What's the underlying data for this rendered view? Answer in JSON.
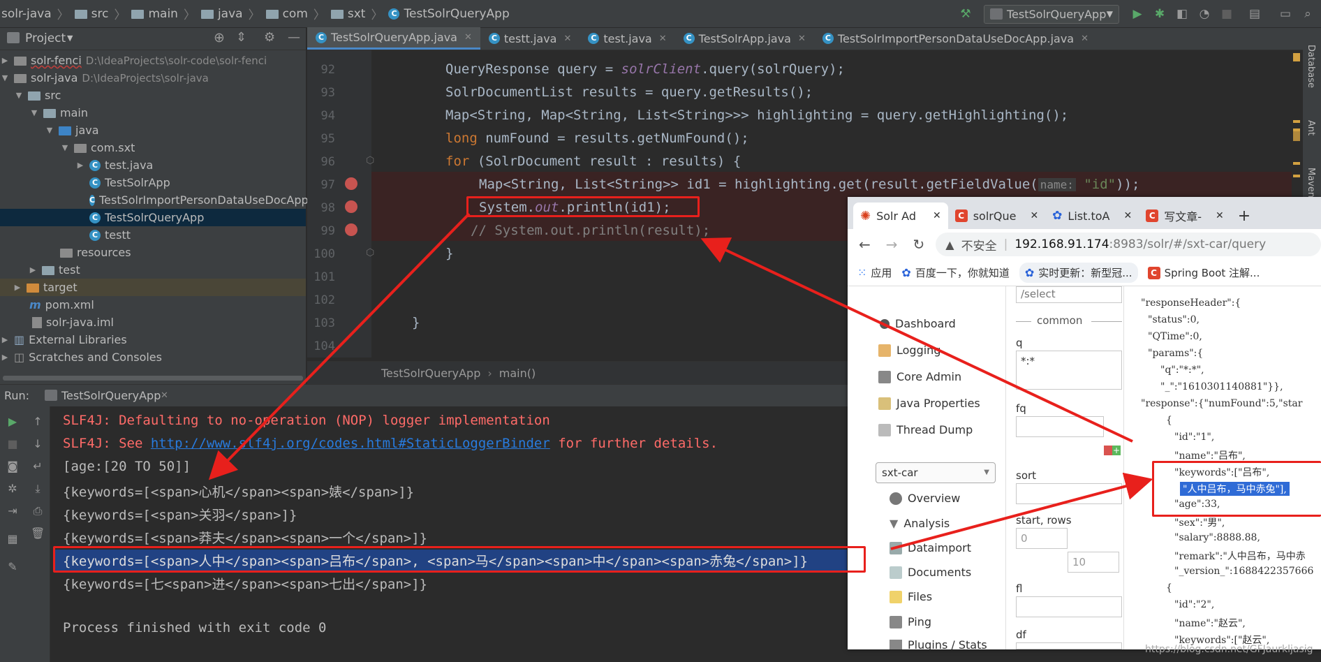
{
  "navbar": {
    "crumbs": [
      "solr-java",
      "src",
      "main",
      "java",
      "com",
      "sxt",
      "TestSolrQueryApp"
    ],
    "run_config": "TestSolrQueryApp"
  },
  "project_panel": {
    "title": "Project",
    "tree": [
      {
        "name": "solr-fenci",
        "path": "D:\\IdeaProjects\\solr-code\\solr-fenci"
      },
      {
        "name": "solr-java",
        "path": "D:\\IdeaProjects\\solr-java"
      },
      {
        "name": "src"
      },
      {
        "name": "main"
      },
      {
        "name": "java"
      },
      {
        "name": "com.sxt"
      },
      {
        "name": "test.java"
      },
      {
        "name": "TestSolrApp"
      },
      {
        "name": "TestSolrImportPersonDataUseDocApp"
      },
      {
        "name": "TestSolrQueryApp"
      },
      {
        "name": "testt"
      },
      {
        "name": "resources"
      },
      {
        "name": "test"
      },
      {
        "name": "target"
      },
      {
        "name": "pom.xml"
      },
      {
        "name": "solr-java.iml"
      },
      {
        "name": "External Libraries"
      },
      {
        "name": "Scratches and Consoles"
      }
    ]
  },
  "editor": {
    "tabs": [
      "TestSolrQueryApp.java",
      "testt.java",
      "test.java",
      "TestSolrApp.java",
      "TestSolrImportPersonDataUseDocApp.java"
    ],
    "line_numbers": [
      "92",
      "93",
      "94",
      "95",
      "96",
      "97",
      "98",
      "99",
      "100",
      "101",
      "102",
      "103",
      "104"
    ],
    "lines": {
      "l92a": "QueryResponse query = ",
      "l92b": "solrClient",
      "l92c": ".query(solrQuery);",
      "l93": "SolrDocumentList results = query.getResults();",
      "l94": "Map<String, Map<String, List<String>>> highlighting = query.getHighlighting();",
      "l95a": "long",
      "l95b": " numFound = results.getNumFound();",
      "l96a": "for",
      "l96b": " (SolrDocument result : results) {",
      "l97a": "Map<String, List<String>> id1 = highlighting.get(result.getFieldValue(",
      "l97hint": "name:",
      "l97str": "\"id\"",
      "l97c": "));",
      "l98a": "System.",
      "l98b": "out",
      "l98c": ".println(id1);",
      "l99": "// System.out.println(result);",
      "l100": "}",
      "l103": "}"
    },
    "breadcrumb": [
      "TestSolrQueryApp",
      "main()"
    ],
    "right_tools": [
      "Database",
      "Ant",
      "Maven"
    ]
  },
  "run_panel": {
    "label": "Run:",
    "tab": "TestSolrQueryApp",
    "output": {
      "o1": "SLF4J: Defaulting to no-operation (NOP) logger implementation",
      "o2a": "SLF4J: See ",
      "o2link": "http://www.slf4j.org/codes.html#StaticLoggerBinder",
      "o2b": " for further details.",
      "o3": "[age:[20 TO 50]]",
      "o4": "{keywords=[<span>心机</span><span>婊</span>]}",
      "o5": "{keywords=[<span>关羽</span>]}",
      "o6": "{keywords=[<span>莽夫</span><span>一个</span>]}",
      "o7": "{keywords=[<span>人中</span><span>吕布</span>, <span>马</span><span>中</span><span>赤兔</span>]}",
      "o8": "{keywords=[七<span>进</span><span>七出</span>]}",
      "o9": "Process finished with exit code 0"
    }
  },
  "browser": {
    "tabs": [
      "Solr Ad",
      "solrQue",
      "List.toA",
      "写文章-"
    ],
    "insecure_label": "不安全",
    "url_host": "192.168.91.174",
    "url_rest": ":8983/solr/#/sxt-car/query",
    "bookmarks": [
      "应用",
      "百度一下，你就知道",
      "实时更新：新型冠...",
      "Spring Boot 注解..."
    ],
    "solr_nav": [
      "Dashboard",
      "Logging",
      "Core Admin",
      "Java Properties",
      "Thread Dump"
    ],
    "core_select": "sxt-car",
    "core_nav": [
      "Overview",
      "Analysis",
      "Dataimport",
      "Documents",
      "Files",
      "Ping",
      "Plugins / Stats"
    ],
    "form": {
      "handler": "/select",
      "section": "common",
      "q_label": "q",
      "q_value": "*:*",
      "fq_label": "fq",
      "sort_label": "sort",
      "start_rows_label": "start, rows",
      "start_value": "0",
      "rows_value": "10",
      "fl_label": "fl",
      "df_label": "df"
    },
    "json": {
      "j1": "\"responseHeader\":{",
      "j2": "\"status\":0,",
      "j3": "\"QTime\":0,",
      "j4": "\"params\":{",
      "j5": "\"q\":\"*:*\",",
      "j6": "\"_\":\"1610301140881\"}},",
      "j7": "\"response\":{\"numFound\":5,\"star",
      "j8": "{",
      "j9": "\"id\":\"1\",",
      "j10": "\"name\":\"吕布\",",
      "j11": "\"keywords\":[\"吕布\",",
      "j12": "\"人中吕布，马中赤兔\"],",
      "j13": "\"age\":33,",
      "j14": "\"sex\":\"男\",",
      "j15": "\"salary\":8888.88,",
      "j16": "\"remark\":\"人中吕布，马中赤",
      "j17": "\"_version_\":1688422357666",
      "j18": "{",
      "j19": "\"id\":\"2\",",
      "j20": "\"name\":\"赵云\",",
      "j21": "\"keywords\":[\"赵云\","
    },
    "watermark": "https://blog.csdn.net/GFJaurkljasig"
  },
  "colors": {
    "annotation_red": "#e8201c",
    "breakpoint": "#c75450",
    "console_error": "#ff6b68",
    "selection": "#214283"
  }
}
